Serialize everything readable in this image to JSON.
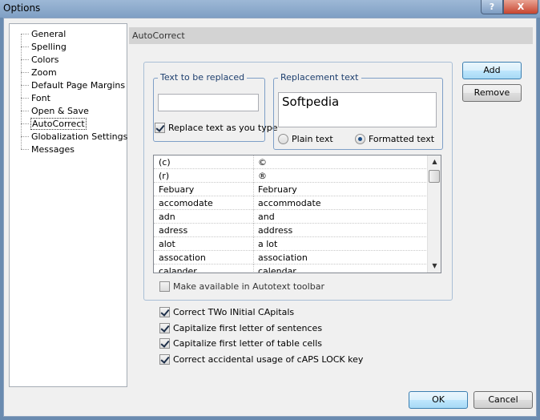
{
  "window": {
    "title": "Options",
    "help_label": "?",
    "close_label": "X"
  },
  "tree": {
    "items": [
      "General",
      "Spelling",
      "Colors",
      "Zoom",
      "Default Page Margins",
      "Font",
      "Open & Save",
      "AutoCorrect",
      "Globalization Settings",
      "Messages"
    ],
    "selected": "AutoCorrect"
  },
  "section": {
    "title": "AutoCorrect"
  },
  "replace_group": {
    "legend": "Text to be replaced",
    "value": ""
  },
  "replace_as_you_type": {
    "label": "Replace text as you type",
    "checked": true
  },
  "replacement_group": {
    "legend": "Replacement text",
    "value": "Softpedia",
    "plain_label": "Plain text",
    "formatted_label": "Formatted text",
    "selected": "Formatted text"
  },
  "buttons": {
    "add": "Add",
    "remove": "Remove",
    "ok": "OK",
    "cancel": "Cancel"
  },
  "table": {
    "rows": [
      [
        "(c)",
        "©"
      ],
      [
        "(r)",
        "®"
      ],
      [
        "Febuary",
        "February"
      ],
      [
        "accomodate",
        "accommodate"
      ],
      [
        "adn",
        "and"
      ],
      [
        "adress",
        "address"
      ],
      [
        "alot",
        "a lot"
      ],
      [
        "assocation",
        "association"
      ],
      [
        "calander",
        "calendar"
      ]
    ]
  },
  "autotext": {
    "label": "Make available in Autotext toolbar",
    "checked": false
  },
  "options": [
    {
      "label": "Correct TWo INitial CApitals",
      "checked": true
    },
    {
      "label": "Capitalize first letter of sentences",
      "checked": true
    },
    {
      "label": "Capitalize first letter of table cells",
      "checked": true
    },
    {
      "label": "Correct accidental usage of cAPS LOCK key",
      "checked": true
    }
  ]
}
